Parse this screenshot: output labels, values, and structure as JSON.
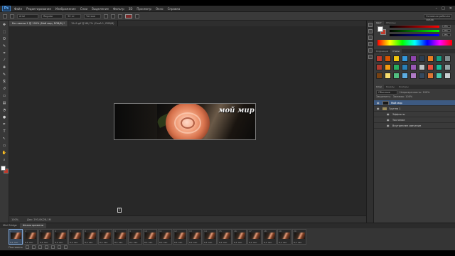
{
  "app": {
    "logo": "Ps"
  },
  "menubar": {
    "items": [
      "Файл",
      "Редактирование",
      "Изображение",
      "Слои",
      "Выделение",
      "Фильтр",
      "3D",
      "Просмотр",
      "Окно",
      "Справка"
    ],
    "window_controls": [
      "–",
      "□",
      "✕"
    ]
  },
  "options": {
    "font": "Arial",
    "style": "Regular",
    "size": "30 пт",
    "aa": "Четкое",
    "workspace": "Основная рабочая среда"
  },
  "documents": {
    "tabs": [
      "Без имени-1 @ 100% (Мой мир, RGB/8) *",
      "12x2.gif @ 66,7% (Слой 1, RGB/8)"
    ]
  },
  "tools": {
    "icons": [
      "move-icon",
      "marquee-icon",
      "lasso-icon",
      "quick-select-icon",
      "crop-icon",
      "eyedropper-icon",
      "healing-icon",
      "brush-icon",
      "stamp-icon",
      "history-brush-icon",
      "eraser-icon",
      "gradient-icon",
      "blur-icon",
      "dodge-icon",
      "pen-icon",
      "type-icon",
      "path-select-icon",
      "shape-icon",
      "hand-icon",
      "zoom-icon"
    ],
    "glyphs": [
      "✥",
      "⬚",
      "ʘ",
      "✎",
      "⌗",
      "⁄",
      "✚",
      "✎",
      "⎘",
      "↺",
      "▭",
      "▤",
      "◔",
      "●",
      "✒",
      "T",
      "↖",
      "▭",
      "✋",
      "⌕"
    ]
  },
  "canvas": {
    "artwork_text": "мой мир",
    "cursor_glyph": "T"
  },
  "status": {
    "zoom": "100%",
    "doc_info": "Док: 293,0K/28,1M"
  },
  "timeline": {
    "tabs": [
      "Mini Bridge",
      "Шкала времени"
    ],
    "frame_count": 20,
    "frame_delay": "0,1 сек.",
    "loop": "Постоянно"
  },
  "panels": {
    "color_tabs": [
      "Цвет",
      "Образцы"
    ],
    "rgb": {
      "r": "255",
      "g": "255",
      "b": "255"
    },
    "styles_tabs": [
      "Коррекция",
      "Стили"
    ],
    "style_colors": [
      "#c0392b",
      "#d35400",
      "#f1c40f",
      "#3498db",
      "#8e44ad",
      "#2c3e50",
      "#e67e22",
      "#16a085",
      "#7f8c8d",
      "#b03a2e",
      "#f39c12",
      "#27ae60",
      "#2980b9",
      "#9b59b6",
      "#bdc3c7",
      "#e74c3c",
      "#1abc9c",
      "#95a5a6",
      "#784212",
      "#f7dc6f",
      "#52be80",
      "#5dade2",
      "#af7ac5",
      "#34495e",
      "#dc7633",
      "#48c9b0",
      "#cacfd2"
    ],
    "layers_tabs": [
      "Слои",
      "Каналы",
      "Контуры"
    ],
    "blend_mode": "Обычные",
    "opacity_label": "Непрозрачность: 100%",
    "lock_label": "Закрепить:",
    "fill_label": "Заливка: 100%",
    "layers": [
      {
        "name": "Мой мир",
        "type": "text",
        "selected": true
      },
      {
        "name": "Группа 1",
        "type": "group",
        "selected": false
      },
      {
        "name": "Эффекты",
        "type": "fx",
        "selected": false
      },
      {
        "name": "Тиснение",
        "type": "fx",
        "selected": false
      },
      {
        "name": "Внутреннее свечение",
        "type": "fx",
        "selected": false
      }
    ]
  }
}
